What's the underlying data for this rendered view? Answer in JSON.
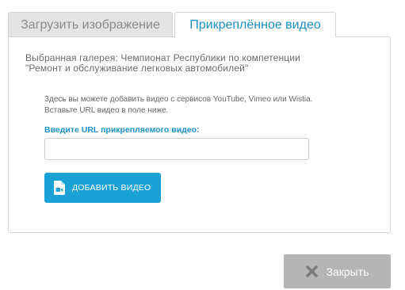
{
  "tabs": [
    {
      "label": "Загрузить изображение",
      "active": false
    },
    {
      "label": "Прикреплённое видео",
      "active": true
    }
  ],
  "panel": {
    "gallery_line1": "Выбранная галерея: Чемпионат Республики по компетенции",
    "gallery_line2": "\"Ремонт и обслуживание легковых автомобилей\"",
    "help_line1": "Здесь вы можете добавить видео с сервисов YouTube, Vimeo или Wistia.",
    "help_line2": "Вставьте URL видео в поле ниже.",
    "url_label": "Введите URL прикрепляемого видео:",
    "url_value": "",
    "url_placeholder": "",
    "add_button_label": "ДОБАВИТЬ ВИДЕО",
    "add_button_icon": "video-file-icon"
  },
  "footer": {
    "close_label": "Закрыть",
    "close_icon": "close-x-icon"
  },
  "colors": {
    "accent": "#1aa1d6",
    "accent_text": "#1a8fc9",
    "close_bg": "#b5b5b5",
    "tab_inactive_bg": "#e4e4e4"
  }
}
